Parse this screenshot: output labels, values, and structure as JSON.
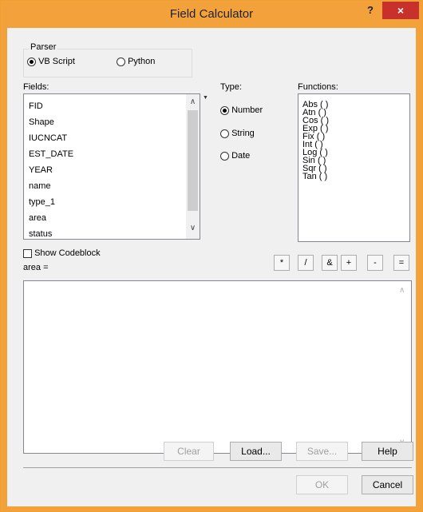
{
  "window": {
    "title": "Field Calculator",
    "help_label": "?",
    "close_label": "×"
  },
  "parser": {
    "label": "Parser",
    "options": [
      {
        "label": "VB Script",
        "selected": true
      },
      {
        "label": "Python",
        "selected": false
      }
    ]
  },
  "fields": {
    "label": "Fields:",
    "items": [
      "FID",
      "Shape",
      "IUCNCAT",
      "EST_DATE",
      "YEAR",
      "name",
      "type_1",
      "area",
      "status"
    ]
  },
  "type": {
    "label": "Type:",
    "options": [
      {
        "label": "Number",
        "selected": true
      },
      {
        "label": "String",
        "selected": false
      },
      {
        "label": "Date",
        "selected": false
      }
    ]
  },
  "functions": {
    "label": "Functions:",
    "items": [
      "Abs ( )",
      "Atn ( )",
      "Cos ( )",
      "Exp ( )",
      "Fix ( )",
      "Int ( )",
      "Log ( )",
      "Sin ( )",
      "Sqr ( )",
      "Tan ( )"
    ]
  },
  "codeblock": {
    "label": "Show Codeblock",
    "checked": false
  },
  "operators": [
    "*",
    "/",
    "&",
    "+",
    "-",
    "="
  ],
  "expression": {
    "label": "area =",
    "value": ""
  },
  "buttons": {
    "clear": "Clear",
    "load": "Load...",
    "save": "Save...",
    "help": "Help",
    "ok": "OK",
    "cancel": "Cancel"
  },
  "colors": {
    "title_bar": "#f3a23b",
    "close": "#c7302b",
    "dialog_bg": "#f0f0f0"
  }
}
